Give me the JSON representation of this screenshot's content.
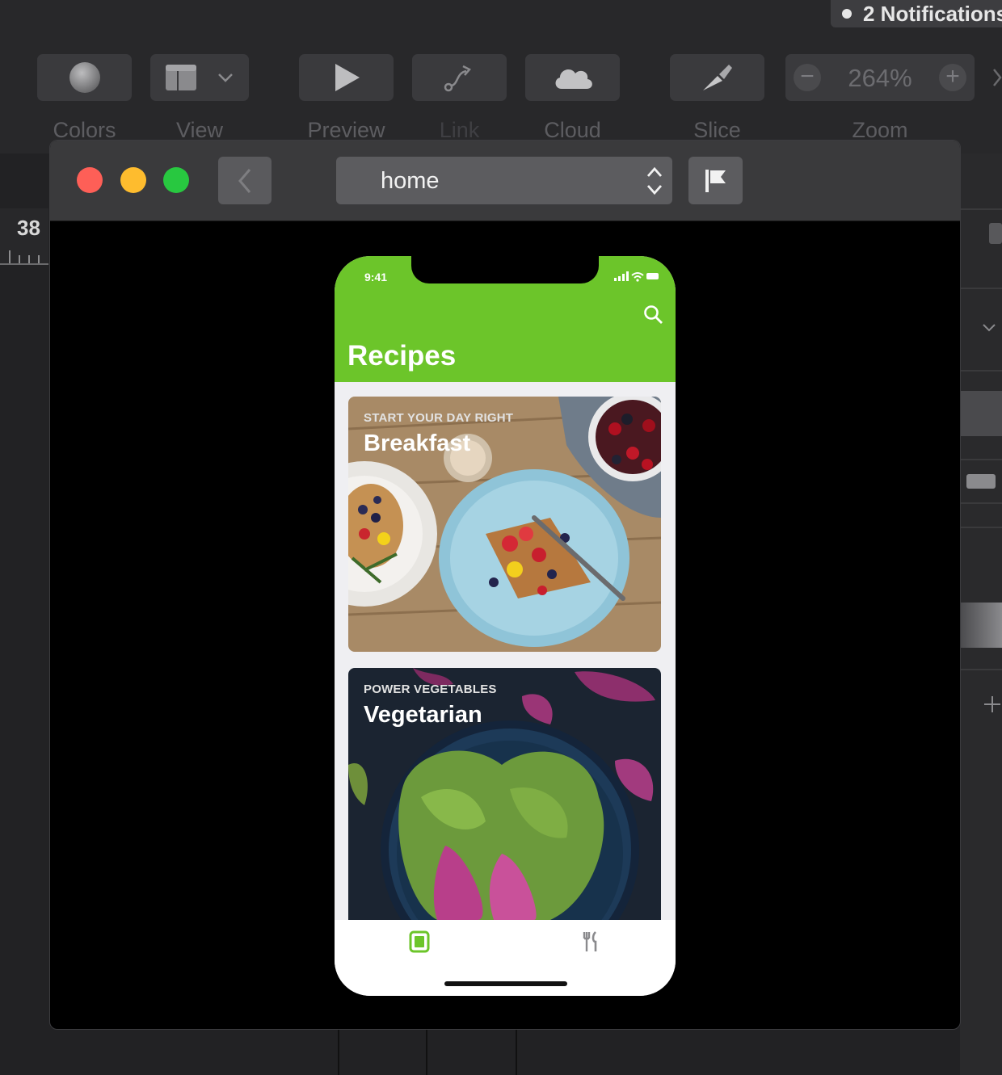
{
  "notification": {
    "text": "2 Notifications"
  },
  "toolbar": {
    "colors_label": "Colors",
    "view_label": "View",
    "preview_label": "Preview",
    "link_label": "Link",
    "cloud_label": "Cloud",
    "slice_label": "Slice",
    "zoom_label": "Zoom",
    "zoom_value": "264%",
    "zoom_minus": "−",
    "zoom_plus": "+"
  },
  "ruler": {
    "value": "38"
  },
  "preview_window": {
    "page_name": "home"
  },
  "app": {
    "status_time": "9:41",
    "title": "Recipes",
    "cards": [
      {
        "subtitle": "START YOUR DAY RIGHT",
        "title": "Breakfast"
      },
      {
        "subtitle": "POWER VEGETABLES",
        "title": "Vegetarian"
      }
    ]
  },
  "colors": {
    "accent_green": "#6cc52a",
    "close": "#fe5f57",
    "minimize": "#febc2e",
    "zoom": "#28c840"
  }
}
